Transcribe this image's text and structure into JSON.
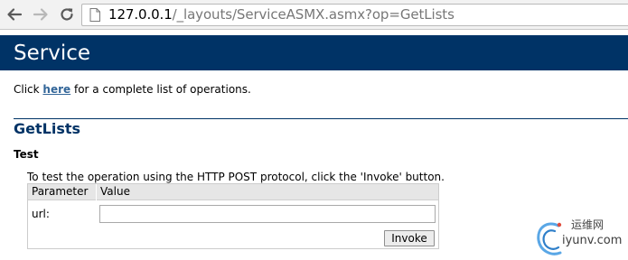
{
  "browser": {
    "url_host": "127.0.0.1",
    "url_path": "/_layouts/ServiceASMX.asmx?op=GetLists"
  },
  "header": {
    "title": "Service"
  },
  "intro": {
    "prefix": "Click ",
    "link_label": "here",
    "suffix": " for a complete list of operations."
  },
  "operation": {
    "name": "GetLists"
  },
  "test": {
    "heading": "Test",
    "description": "To test the operation using the HTTP POST protocol, click the 'Invoke' button.",
    "table": {
      "col_parameter": "Parameter",
      "col_value": "Value",
      "param_label": "url:",
      "param_value": "",
      "invoke_label": "Invoke"
    }
  },
  "watermark": {
    "chinese": "运维网",
    "site": "iyunv.com"
  },
  "colors": {
    "header_bg": "#003366",
    "link": "#336699",
    "operation_title": "#003366"
  }
}
